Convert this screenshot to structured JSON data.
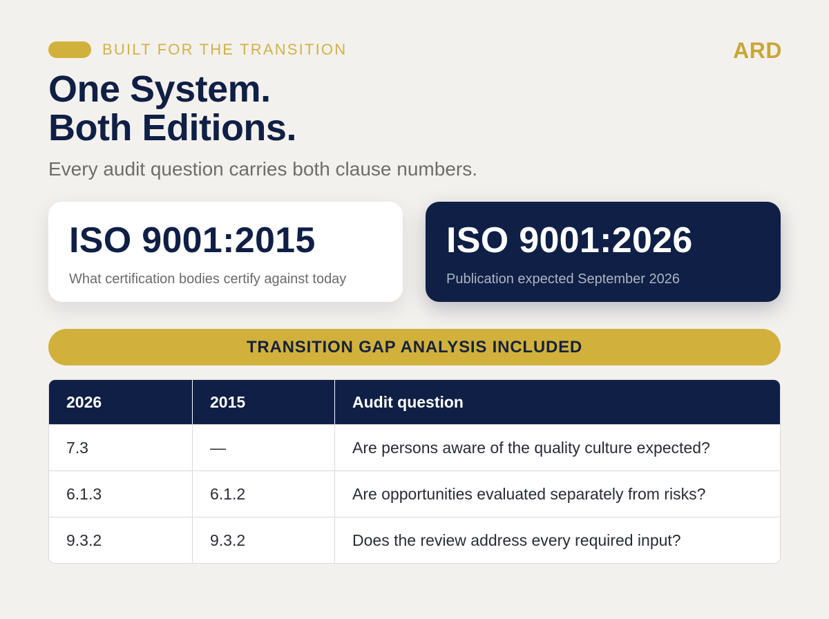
{
  "eyebrow": {
    "text": "BUILT FOR THE TRANSITION"
  },
  "brand": "ARD",
  "headline": {
    "line1": "One System.",
    "line2": "Both Editions."
  },
  "subhead": "Every audit question carries both clause numbers.",
  "cards": [
    {
      "title": "ISO 9001:2015",
      "caption": "What certification bodies certify against today"
    },
    {
      "title": "ISO 9001:2026",
      "caption": "Publication expected September 2026"
    }
  ],
  "banner": "TRANSITION GAP ANALYSIS INCLUDED",
  "table": {
    "headers": [
      "2026",
      "2015",
      "Audit question"
    ],
    "rows": [
      [
        "7.3",
        "—",
        "Are persons aware of the quality culture expected?"
      ],
      [
        "6.1.3",
        "6.1.2",
        "Are opportunities evaluated separately from risks?"
      ],
      [
        "9.3.2",
        "9.3.2",
        "Does the review address every required input?"
      ]
    ]
  },
  "colors": {
    "background": "#f3f1ed",
    "navy": "#0f1f45",
    "gold": "#d1b13c",
    "gold_text": "#c8a73a",
    "muted_text": "#6f6d6a"
  }
}
